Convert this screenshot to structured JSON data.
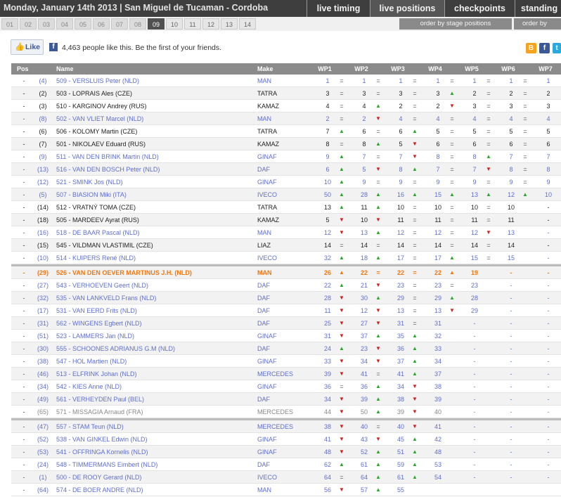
{
  "topbar": {
    "title": "Monday, January 14th 2013 | San Miguel de Tucaman - Cordoba",
    "tabs": [
      "live timing",
      "live positions",
      "checkpoints",
      "standing"
    ]
  },
  "stages": [
    "01",
    "02",
    "03",
    "04",
    "05",
    "06",
    "07",
    "08",
    "09",
    "10",
    "11",
    "12",
    "13",
    "14"
  ],
  "active_stage": "09",
  "order_buttons": [
    "order by stage positions",
    "order by"
  ],
  "like": {
    "button_label": "Like",
    "text": "4,463 people like this. Be the first of your friends."
  },
  "share_icons": [
    "B",
    "f",
    "t"
  ],
  "table": {
    "headers": {
      "pos": "Pos",
      "name": "Name",
      "make": "Make",
      "wps": [
        "WP1",
        "WP2",
        "WP3",
        "WP4",
        "WP5",
        "WP6",
        "WP7"
      ]
    },
    "rows": [
      {
        "pos": "-",
        "prev": "(4)",
        "name": "509 - VERSLUIS Peter (NLD)",
        "make": "MAN",
        "style": "blue",
        "wp": [
          "1",
          "1",
          "1",
          "1",
          "1",
          "1",
          "1"
        ],
        "ind": [
          "=",
          "=",
          "=",
          "=",
          "=",
          "="
        ]
      },
      {
        "pos": "-",
        "prev": "(2)",
        "name": "503 - LOPRAIS Ales (CZE)",
        "make": "TATRA",
        "style": "dark",
        "wp": [
          "3",
          "3",
          "3",
          "3",
          "2",
          "2",
          "2"
        ],
        "ind": [
          "=",
          "=",
          "=",
          "up",
          "=",
          "="
        ]
      },
      {
        "pos": "-",
        "prev": "(3)",
        "name": "510 - KARGINOV Andrey (RUS)",
        "make": "KAMAZ",
        "style": "dark",
        "wp": [
          "4",
          "4",
          "2",
          "2",
          "3",
          "3",
          "3"
        ],
        "ind": [
          "=",
          "up",
          "=",
          "down",
          "=",
          "="
        ]
      },
      {
        "pos": "-",
        "prev": "(8)",
        "name": "502 - VAN VLIET Marcel (NLD)",
        "make": "MAN",
        "style": "blue",
        "wp": [
          "2",
          "2",
          "4",
          "4",
          "4",
          "4",
          "4"
        ],
        "ind": [
          "=",
          "down",
          "=",
          "=",
          "=",
          "="
        ]
      },
      {
        "pos": "-",
        "prev": "(6)",
        "name": "506 - KOLOMY Martin (CZE)",
        "make": "TATRA",
        "style": "dark",
        "wp": [
          "7",
          "6",
          "6",
          "5",
          "5",
          "5",
          "5"
        ],
        "ind": [
          "up",
          "=",
          "up",
          "=",
          "=",
          "="
        ]
      },
      {
        "pos": "-",
        "prev": "(7)",
        "name": "501 - NIKOLAEV Eduard (RUS)",
        "make": "KAMAZ",
        "style": "dark",
        "wp": [
          "8",
          "8",
          "5",
          "6",
          "6",
          "6",
          "6"
        ],
        "ind": [
          "=",
          "up",
          "down",
          "=",
          "=",
          "="
        ]
      },
      {
        "pos": "-",
        "prev": "(9)",
        "name": "511 - VAN DEN BRINK Martin (NLD)",
        "make": "GINAF",
        "style": "blue",
        "wp": [
          "9",
          "7",
          "7",
          "8",
          "8",
          "7",
          "7"
        ],
        "ind": [
          "up",
          "=",
          "down",
          "=",
          "up",
          "="
        ]
      },
      {
        "pos": "-",
        "prev": "(13)",
        "name": "516 - VAN DEN BOSCH Peter (NLD)",
        "make": "DAF",
        "style": "blue",
        "wp": [
          "6",
          "5",
          "8",
          "7",
          "7",
          "8",
          "8"
        ],
        "ind": [
          "up",
          "down",
          "up",
          "=",
          "down",
          "="
        ]
      },
      {
        "pos": "-",
        "prev": "(12)",
        "name": "521 - SMINK Jos (NLD)",
        "make": "GINAF",
        "style": "blue",
        "wp": [
          "10",
          "9",
          "9",
          "9",
          "9",
          "9",
          "9"
        ],
        "ind": [
          "up",
          "=",
          "=",
          "=",
          "=",
          "="
        ]
      },
      {
        "pos": "-",
        "prev": "(5)",
        "name": "507 - BIASION Miki (ITA)",
        "make": "IVECO",
        "style": "blue",
        "wp": [
          "50",
          "28",
          "16",
          "15",
          "13",
          "12",
          "10"
        ],
        "ind": [
          "up",
          "up",
          "up",
          "up",
          "up",
          "up"
        ]
      },
      {
        "pos": "-",
        "prev": "(14)",
        "name": "512 - VRATNÝ TOMA (CZE)",
        "make": "TATRA",
        "style": "dark",
        "wp": [
          "13",
          "11",
          "10",
          "10",
          "10",
          "10",
          "-"
        ],
        "ind": [
          "up",
          "up",
          "=",
          "=",
          "=",
          ""
        ]
      },
      {
        "pos": "-",
        "prev": "(18)",
        "name": "505 - MARDEEV Ayrat (RUS)",
        "make": "KAMAZ",
        "style": "dark",
        "wp": [
          "5",
          "10",
          "11",
          "11",
          "11",
          "11",
          "-"
        ],
        "ind": [
          "down",
          "down",
          "=",
          "=",
          "=",
          ""
        ]
      },
      {
        "pos": "-",
        "prev": "(16)",
        "name": "518 - DE BAAR Pascal (NLD)",
        "make": "MAN",
        "style": "blue",
        "wp": [
          "12",
          "13",
          "12",
          "12",
          "12",
          "13",
          "-"
        ],
        "ind": [
          "down",
          "up",
          "=",
          "=",
          "down",
          ""
        ]
      },
      {
        "pos": "-",
        "prev": "(15)",
        "name": "545 - VILDMAN VLASTIMIL (CZE)",
        "make": "LIAZ",
        "style": "dark",
        "wp": [
          "14",
          "14",
          "14",
          "14",
          "14",
          "14",
          "-"
        ],
        "ind": [
          "=",
          "=",
          "=",
          "=",
          "=",
          ""
        ]
      },
      {
        "pos": "-",
        "prev": "(10)",
        "name": "514 - KUIPERS René (NLD)",
        "make": "IVECO",
        "style": "blue",
        "wp": [
          "32",
          "18",
          "17",
          "17",
          "15",
          "15",
          "-"
        ],
        "ind": [
          "up",
          "up",
          "=",
          "up",
          "=",
          ""
        ]
      },
      {
        "pos": "-",
        "prev": "(29)",
        "name": "526 - VAN DEN OEVER MARTINUS J.H. (NLD)",
        "make": "MAN",
        "style": "orange",
        "wp": [
          "26",
          "22",
          "22",
          "22",
          "19",
          "-",
          "-"
        ],
        "ind": [
          "up",
          "=",
          "=",
          "up",
          "",
          ""
        ]
      },
      {
        "pos": "-",
        "prev": "(27)",
        "name": "543 - VERHOEVEN Geert (NLD)",
        "make": "DAF",
        "style": "blue",
        "wp": [
          "22",
          "21",
          "23",
          "23",
          "23",
          "-",
          "-"
        ],
        "ind": [
          "up",
          "down",
          "=",
          "=",
          "",
          ""
        ]
      },
      {
        "pos": "-",
        "prev": "(32)",
        "name": "535 - VAN LANKVELD Frans (NLD)",
        "make": "DAF",
        "style": "blue",
        "wp": [
          "28",
          "30",
          "29",
          "29",
          "28",
          "-",
          "-"
        ],
        "ind": [
          "down",
          "up",
          "=",
          "up",
          "",
          ""
        ]
      },
      {
        "pos": "-",
        "prev": "(17)",
        "name": "531 - VAN EERD Frits (NLD)",
        "make": "DAF",
        "style": "blue",
        "wp": [
          "11",
          "12",
          "13",
          "13",
          "29",
          "-",
          "-"
        ],
        "ind": [
          "down",
          "down",
          "=",
          "down",
          "",
          ""
        ]
      },
      {
        "pos": "-",
        "prev": "(31)",
        "name": "562 - WINGENS Egbert (NLD)",
        "make": "DAF",
        "style": "blue",
        "wp": [
          "25",
          "27",
          "31",
          "31",
          "-",
          "-",
          "-"
        ],
        "ind": [
          "down",
          "down",
          "=",
          "",
          "",
          ""
        ]
      },
      {
        "pos": "-",
        "prev": "(51)",
        "name": "523 - LAMMERS Jan (NLD)",
        "make": "GINAF",
        "style": "blue",
        "wp": [
          "31",
          "37",
          "35",
          "32",
          "-",
          "-",
          "-"
        ],
        "ind": [
          "down",
          "up",
          "up",
          "",
          "",
          ""
        ]
      },
      {
        "pos": "-",
        "prev": "(30)",
        "name": "555 - SCHOONES ADRIANUS G.M (NLD)",
        "make": "DAF",
        "style": "blue",
        "wp": [
          "24",
          "23",
          "36",
          "33",
          "-",
          "-",
          "-"
        ],
        "ind": [
          "up",
          "down",
          "up",
          "",
          "",
          ""
        ]
      },
      {
        "pos": "-",
        "prev": "(38)",
        "name": "547 - HOL Martien (NLD)",
        "make": "GINAF",
        "style": "blue",
        "wp": [
          "33",
          "34",
          "37",
          "34",
          "-",
          "-",
          "-"
        ],
        "ind": [
          "down",
          "down",
          "up",
          "",
          "",
          ""
        ]
      },
      {
        "pos": "-",
        "prev": "(46)",
        "name": "513 - ELFRINK Johan (NLD)",
        "make": "MERCEDES",
        "style": "blue",
        "wp": [
          "39",
          "41",
          "41",
          "37",
          "-",
          "-",
          "-"
        ],
        "ind": [
          "down",
          "=",
          "up",
          "",
          "",
          ""
        ]
      },
      {
        "pos": "-",
        "prev": "(34)",
        "name": "542 - KIES Anne (NLD)",
        "make": "GINAF",
        "style": "blue",
        "wp": [
          "36",
          "36",
          "34",
          "38",
          "-",
          "-",
          "-"
        ],
        "ind": [
          "=",
          "up",
          "down",
          "",
          "",
          ""
        ]
      },
      {
        "pos": "-",
        "prev": "(49)",
        "name": "561 - VERHEYDEN Paul (BEL)",
        "make": "DAF",
        "style": "blue",
        "wp": [
          "34",
          "39",
          "38",
          "39",
          "-",
          "-",
          "-"
        ],
        "ind": [
          "down",
          "up",
          "down",
          "",
          "",
          ""
        ]
      },
      {
        "pos": "-",
        "prev": "(65)",
        "name": "571 - MISSAGIA Arnaud (FRA)",
        "make": "MERCEDES",
        "style": "grey",
        "wp": [
          "44",
          "50",
          "39",
          "40",
          "-",
          "-",
          "-"
        ],
        "ind": [
          "down",
          "up",
          "down",
          "",
          "",
          ""
        ]
      },
      {
        "pos": "-",
        "prev": "(47)",
        "name": "557 - STAM Teun (NLD)",
        "make": "MERCEDES",
        "style": "blue",
        "wp": [
          "38",
          "40",
          "40",
          "41",
          "-",
          "-",
          "-"
        ],
        "ind": [
          "down",
          "=",
          "down",
          "",
          "",
          ""
        ]
      },
      {
        "pos": "-",
        "prev": "(52)",
        "name": "538 - VAN GINKEL Edwin (NLD)",
        "make": "GINAF",
        "style": "blue",
        "wp": [
          "41",
          "43",
          "45",
          "42",
          "-",
          "-",
          "-"
        ],
        "ind": [
          "down",
          "down",
          "up",
          "",
          "",
          ""
        ]
      },
      {
        "pos": "-",
        "prev": "(53)",
        "name": "541 - OFFRINGA Kornelis (NLD)",
        "make": "GINAF",
        "style": "blue",
        "wp": [
          "48",
          "52",
          "51",
          "48",
          "-",
          "-",
          "-"
        ],
        "ind": [
          "down",
          "up",
          "up",
          "",
          "",
          ""
        ]
      },
      {
        "pos": "-",
        "prev": "(24)",
        "name": "548 - TIMMERMANS Eimbert (NLD)",
        "make": "DAF",
        "style": "blue",
        "wp": [
          "62",
          "61",
          "59",
          "53",
          "-",
          "-",
          "-"
        ],
        "ind": [
          "up",
          "up",
          "up",
          "",
          "",
          ""
        ]
      },
      {
        "pos": "-",
        "prev": "(1)",
        "name": "500 - DE ROOY Gerard (NLD)",
        "make": "IVECO",
        "style": "blue",
        "wp": [
          "64",
          "64",
          "61",
          "54",
          "-",
          "-",
          "-"
        ],
        "ind": [
          "=",
          "up",
          "up",
          "",
          "",
          ""
        ]
      },
      {
        "pos": "-",
        "prev": "(64)",
        "name": "574 - DE BOER ANDRE (NLD)",
        "make": "MAN",
        "style": "blue",
        "wp": [
          "56",
          "57",
          "55",
          "",
          "",
          "",
          ""
        ],
        "ind": [
          "down",
          "up",
          "",
          "",
          "",
          ""
        ]
      }
    ]
  }
}
